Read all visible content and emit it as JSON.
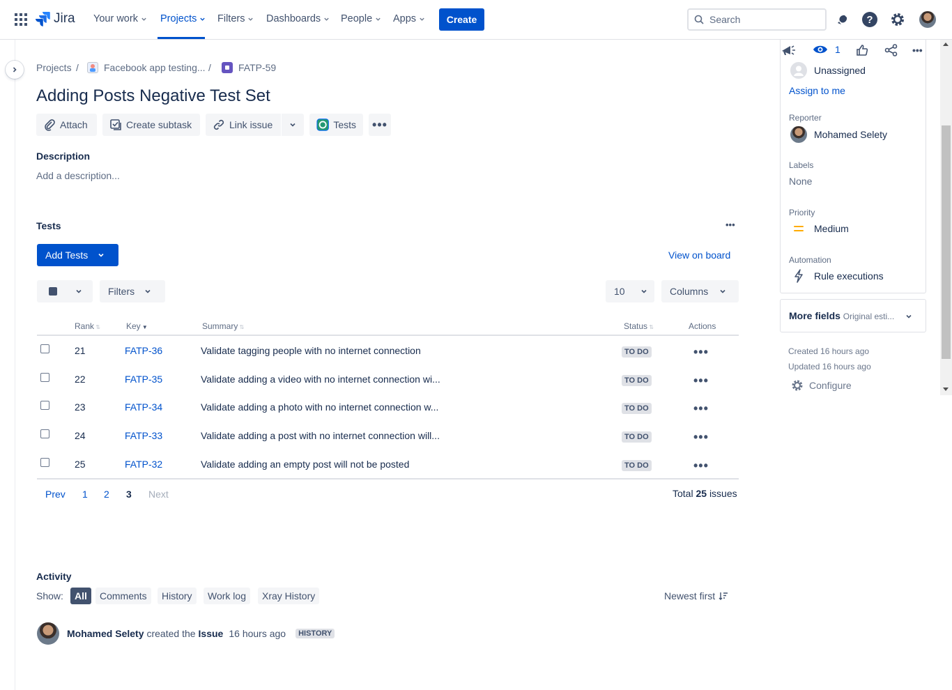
{
  "nav": {
    "logo_text": "Jira",
    "items": [
      {
        "label": "Your work"
      },
      {
        "label": "Projects"
      },
      {
        "label": "Filters"
      },
      {
        "label": "Dashboards"
      },
      {
        "label": "People"
      },
      {
        "label": "Apps"
      }
    ],
    "create_label": "Create",
    "search_placeholder": "Search"
  },
  "breadcrumb": {
    "projects": "Projects",
    "separator": "/",
    "project": "Facebook app testing...",
    "issue_key": "FATP-59"
  },
  "issue": {
    "title": "Adding Posts Negative Test Set",
    "toolbar": {
      "attach": "Attach",
      "create_subtask": "Create subtask",
      "link_issue": "Link issue",
      "tests": "Tests"
    },
    "description_label": "Description",
    "description_placeholder": "Add a description..."
  },
  "tests_panel": {
    "title": "Tests",
    "add_tests": "Add Tests",
    "view_on_board": "View on board",
    "filters": "Filters",
    "page_size": "10",
    "columns": "Columns",
    "headers": {
      "rank": "Rank",
      "key": "Key",
      "summary": "Summary",
      "status": "Status",
      "actions": "Actions"
    },
    "rows": [
      {
        "rank": "21",
        "key": "FATP-36",
        "summary": "Validate tagging people with no internet connection",
        "status": "TO DO"
      },
      {
        "rank": "22",
        "key": "FATP-35",
        "summary": "Validate adding a video with no internet connection wi...",
        "status": "TO DO"
      },
      {
        "rank": "23",
        "key": "FATP-34",
        "summary": "Validate adding a photo with no internet connection w...",
        "status": "TO DO"
      },
      {
        "rank": "24",
        "key": "FATP-33",
        "summary": "Validate adding a post with no internet connection will...",
        "status": "TO DO"
      },
      {
        "rank": "25",
        "key": "FATP-32",
        "summary": "Validate adding an empty post will not be posted",
        "status": "TO DO"
      }
    ],
    "pagination": {
      "prev": "Prev",
      "pages": [
        "1",
        "2",
        "3"
      ],
      "current": "3",
      "next": "Next"
    },
    "total_prefix": "Total",
    "total_count": "25",
    "total_suffix": "issues"
  },
  "activity": {
    "title": "Activity",
    "show_label": "Show:",
    "tabs": [
      "All",
      "Comments",
      "History",
      "Work log",
      "Xray History"
    ],
    "active_tab": "All",
    "sort_label": "Newest first",
    "entry": {
      "user": "Mohamed Selety",
      "action": "created the",
      "object": "Issue",
      "time": "16 hours ago",
      "badge": "HISTORY"
    }
  },
  "sidebar": {
    "watchers_count": "1",
    "assignee_value": "Unassigned",
    "assign_to_me": "Assign to me",
    "reporter_label": "Reporter",
    "reporter_value": "Mohamed Selety",
    "labels_label": "Labels",
    "labels_value": "None",
    "priority_label": "Priority",
    "priority_value": "Medium",
    "priority_color": "#ffab00",
    "automation_label": "Automation",
    "automation_value": "Rule executions",
    "more_fields_label": "More fields",
    "more_fields_hint": "Original esti...",
    "created": "Created 16 hours ago",
    "updated": "Updated 16 hours ago",
    "configure": "Configure"
  },
  "colors": {
    "accent": "#0052cc",
    "status_todo_bg": "#dfe1e6"
  }
}
